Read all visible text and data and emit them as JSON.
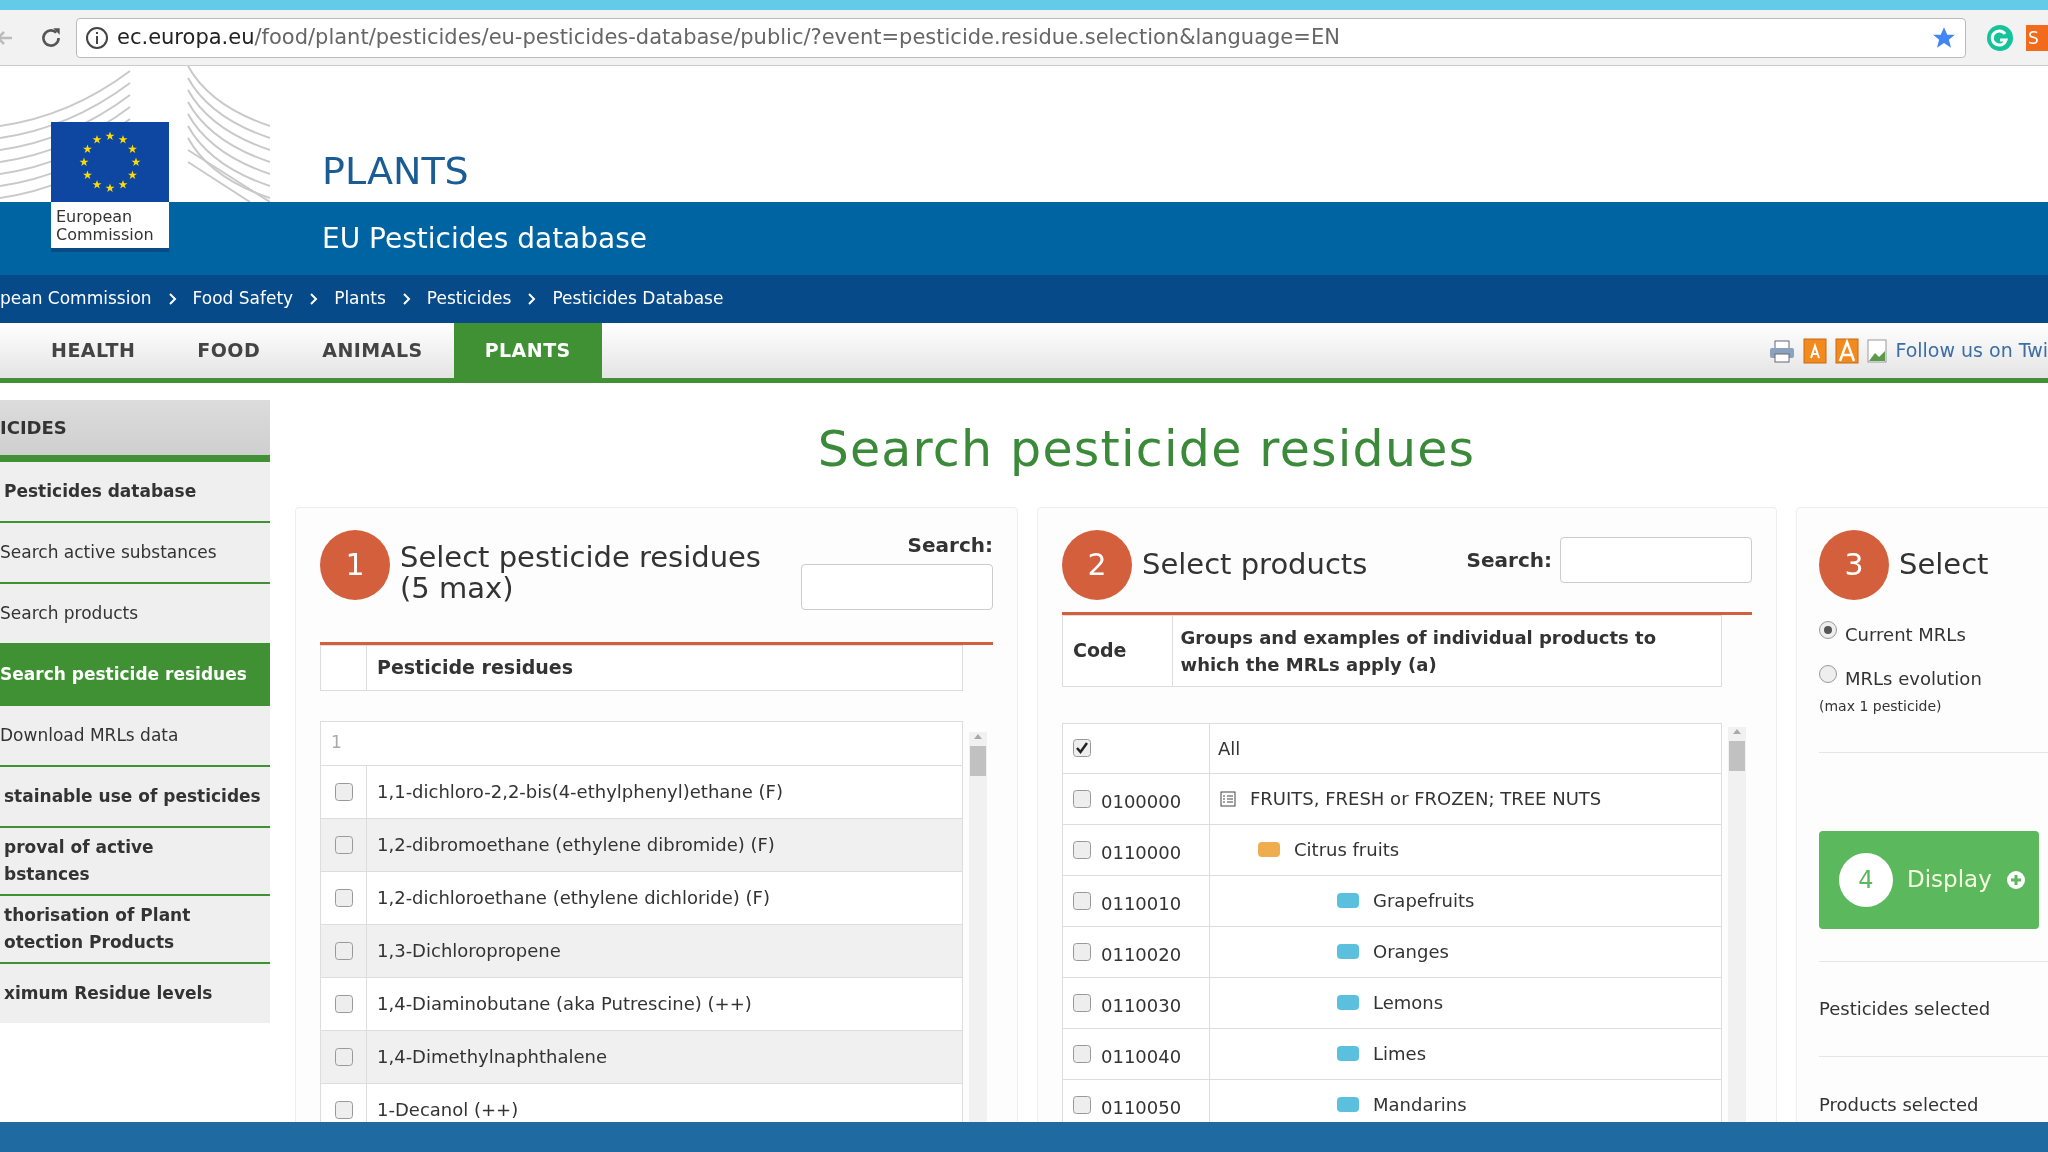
{
  "browser": {
    "url_host": "ec.europa.eu",
    "url_path": "/food/plant/pesticides/eu-pesticides-database/public/?event=pesticide.residue.selection&language=EN",
    "extension_label": "S"
  },
  "header": {
    "logo_line1": "European",
    "logo_line2": "Commission",
    "site_title": "PLANTS",
    "subtitle": "EU Pesticides database"
  },
  "breadcrumb": [
    "pean Commission",
    "Food Safety",
    "Plants",
    "Pesticides",
    "Pesticides Database"
  ],
  "nav": [
    {
      "label": "HEALTH",
      "selected": false
    },
    {
      "label": "FOOD",
      "selected": false
    },
    {
      "label": "ANIMALS",
      "selected": false
    },
    {
      "label": "PLANTS",
      "selected": true
    }
  ],
  "tools": {
    "follow_label": "Follow us on Twi"
  },
  "sidebar": {
    "title": "ICIDES",
    "items": [
      {
        "label": "Pesticides database",
        "kind": "section",
        "selected": false
      },
      {
        "label": "Search active substances",
        "kind": "sub",
        "selected": false
      },
      {
        "label": "Search products",
        "kind": "sub",
        "selected": false
      },
      {
        "label": "Search pesticide residues",
        "kind": "sub",
        "selected": true
      },
      {
        "label": "Download MRLs data",
        "kind": "sub",
        "selected": false
      },
      {
        "label": "stainable use of pesticides",
        "kind": "section",
        "selected": false
      },
      {
        "label": "proval of active\nbstances",
        "kind": "section",
        "selected": false
      },
      {
        "label": "thorisation of Plant\notection Products",
        "kind": "section",
        "selected": false
      },
      {
        "label": "ximum Residue levels",
        "kind": "section",
        "selected": false
      }
    ]
  },
  "page_title": "Search pesticide residues",
  "step1": {
    "number": "1",
    "title": "Select pesticide residues (5 max)",
    "search_label": "Search:",
    "column": "Pesticide residues",
    "filter": "1",
    "rows": [
      {
        "label": "1,1-dichloro-2,2-bis(4-ethylphenyl)ethane (F)",
        "checked": false
      },
      {
        "label": "1,2-dibromoethane (ethylene dibromide) (F)",
        "checked": false
      },
      {
        "label": "1,2-dichloroethane (ethylene dichloride) (F)",
        "checked": false
      },
      {
        "label": "1,3-Dichloropropene",
        "checked": false
      },
      {
        "label": "1,4-Diaminobutane (aka Putrescine) (++)",
        "checked": false
      },
      {
        "label": "1,4-Dimethylnaphthalene",
        "checked": false
      },
      {
        "label": "1-Decanol (++)",
        "checked": false
      }
    ]
  },
  "step2": {
    "number": "2",
    "title": "Select products",
    "search_label": "Search:",
    "columns": [
      "Code",
      "Groups and examples of individual products to which the MRLs apply (a)"
    ],
    "all_row": {
      "label": "All",
      "checked": true
    },
    "rows": [
      {
        "code": "0100000",
        "label": "FRUITS, FRESH or FROZEN; TREE NUTS",
        "checked": false,
        "children": [
          {
            "code": "0110000",
            "label": "Citrus fruits",
            "checked": false,
            "children": [
              {
                "code": "0110010",
                "label": "Grapefruits",
                "checked": false
              },
              {
                "code": "0110020",
                "label": "Oranges",
                "checked": false
              },
              {
                "code": "0110030",
                "label": "Lemons",
                "checked": false
              },
              {
                "code": "0110040",
                "label": "Limes",
                "checked": false
              },
              {
                "code": "0110050",
                "label": "Mandarins",
                "checked": false
              }
            ]
          }
        ]
      }
    ]
  },
  "step3": {
    "number": "3",
    "title": "Select",
    "options": [
      {
        "label": "Current MRLs",
        "selected": true
      },
      {
        "label": "MRLs evolution",
        "note": "(max 1 pesticide)",
        "selected": false
      }
    ],
    "display_button": {
      "number": "4",
      "label": "Display"
    },
    "summaries": [
      "Pesticides selected",
      "Products selected"
    ]
  }
}
